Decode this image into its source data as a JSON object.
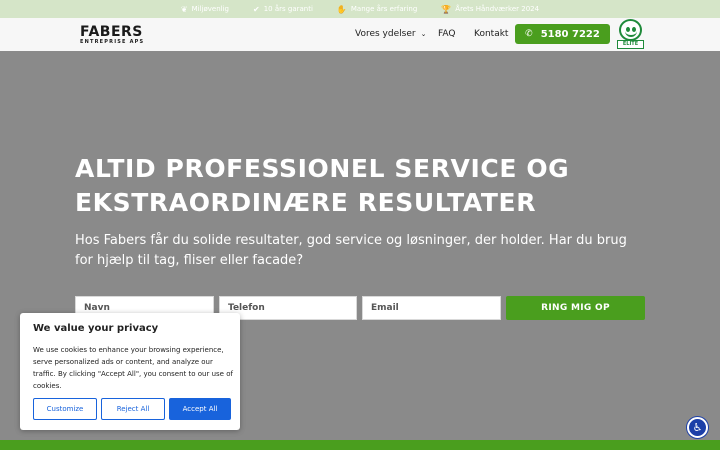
{
  "topbar": {
    "items": [
      {
        "icon": "leaf-icon",
        "glyph": "❦",
        "label": "Miljøvenlig"
      },
      {
        "icon": "check-icon",
        "glyph": "✔",
        "label": "10 års garanti"
      },
      {
        "icon": "handshake-icon",
        "glyph": "✋",
        "label": "Mange års erfaring"
      },
      {
        "icon": "trophy-icon",
        "glyph": "🏆",
        "label": "Årets Håndværker 2024"
      }
    ]
  },
  "brand": {
    "name": "FABERS",
    "tagline": "ENTREPRISE APS"
  },
  "nav": {
    "services_label": "Vores ydelser",
    "faq_label": "FAQ",
    "contact_label": "Kontakt",
    "phone_label": "5180 7222"
  },
  "elite_badge": {
    "label": "ELITE"
  },
  "hero": {
    "title": "ALTID PROFESSIONEL SERVICE OG EKSTRAORDINÆRE RESULTATER",
    "subtitle": "Hos Fabers får du solide resultater, god service og løsninger, der holder. Har du brug for hjælp til tag, fliser eller facade?"
  },
  "form": {
    "name_placeholder": "Navn",
    "phone_placeholder": "Telefon",
    "email_placeholder": "Email",
    "submit_label": "RING MIG OP"
  },
  "cookie": {
    "title": "We value your privacy",
    "text": "We use cookies to enhance your browsing experience, serve personalized ads or content, and analyze our traffic. By clicking \"Accept All\", you consent to our use of cookies.",
    "customize_label": "Customize",
    "reject_label": "Reject All",
    "accept_label": "Accept All"
  },
  "colors": {
    "brand_green": "#4a9e1e",
    "topbar_bg": "#d5e5c8",
    "hero_bg": "#8a8a8a",
    "cookie_blue": "#1863dc",
    "a11y_blue": "#1c3fa8"
  }
}
